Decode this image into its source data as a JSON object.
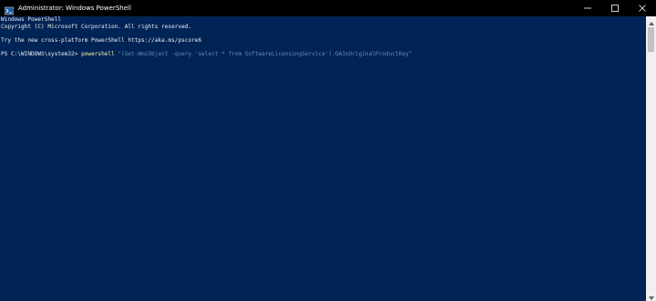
{
  "window": {
    "title": "Administrator: Windows PowerShell",
    "icon": "powershell-icon",
    "controls": [
      "minimize-icon",
      "maximize-icon",
      "close-icon"
    ]
  },
  "console": {
    "lines": [
      "Windows PowerShell",
      "Copyright (C) Microsoft Corporation. All rights reserved.",
      "",
      "Try the new cross-platform PowerShell https://aka.ms/pscore6",
      ""
    ],
    "prompt": "PS C:\\WINDOWS\\system32> ",
    "command_keyword": "powershell",
    "command_args": " \"(Get-WmiObject -query 'select * from SoftwareLicensingService').OA3xOriginalProductKey\""
  },
  "colors": {
    "background": "#012456",
    "foreground": "#eeedf0",
    "keyword": "#f9f1a5",
    "argument": "#6c8bb3",
    "titlebar": "#000000"
  }
}
